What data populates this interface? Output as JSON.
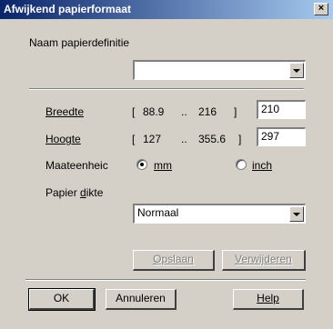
{
  "window": {
    "title": "Afwijkend papierformaat",
    "close_glyph": "×"
  },
  "paper_def": {
    "label": "Naam papierdefinitie",
    "value": ""
  },
  "width": {
    "label": "Breedte",
    "open": "[",
    "min": "88.9",
    "sep": "..",
    "max": "216",
    "close": "]",
    "value": "210"
  },
  "height": {
    "label": "Hoogte",
    "open": "[",
    "min": "127",
    "sep": "..",
    "max": "355.6",
    "close": "]",
    "value": "297"
  },
  "unit": {
    "label": "Maateenheic",
    "options": [
      {
        "label": "mm",
        "selected": true
      },
      {
        "label": "inch",
        "selected": false
      }
    ]
  },
  "thickness": {
    "label": "Papier dikte",
    "value": "Normaal"
  },
  "buttons": {
    "save": "Opslaan",
    "delete": "Verwijderen",
    "ok": "OK",
    "cancel": "Annuleren",
    "help": "Help"
  }
}
